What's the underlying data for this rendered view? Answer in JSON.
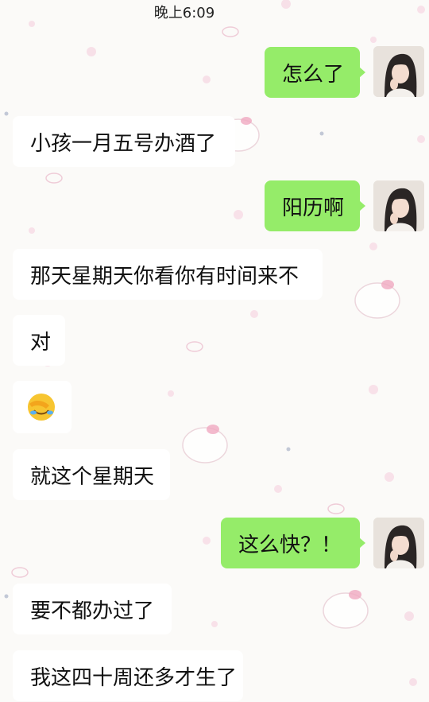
{
  "status_bar": {
    "time": "晚上6:09"
  },
  "messages": [
    {
      "side": "right",
      "text": "怎么了"
    },
    {
      "side": "left",
      "text": "小孩一月五号办酒了"
    },
    {
      "side": "right",
      "text": "阳历啊"
    },
    {
      "side": "left",
      "text": "那天星期天你看你有时间来不"
    },
    {
      "side": "left",
      "text": "对"
    },
    {
      "side": "left",
      "emoji": "face-palm-emoji"
    },
    {
      "side": "left",
      "text": "就这个星期天"
    },
    {
      "side": "right",
      "text": "这么快？！"
    },
    {
      "side": "left",
      "text": "要不都办过了"
    },
    {
      "side": "left",
      "text": "我这四十周还多才生了"
    }
  ],
  "colors": {
    "sent_bubble": "#95ec69",
    "received_bubble": "#ffffff",
    "background": "#fbfaf8",
    "pattern_pink": "#f3c3d4"
  }
}
